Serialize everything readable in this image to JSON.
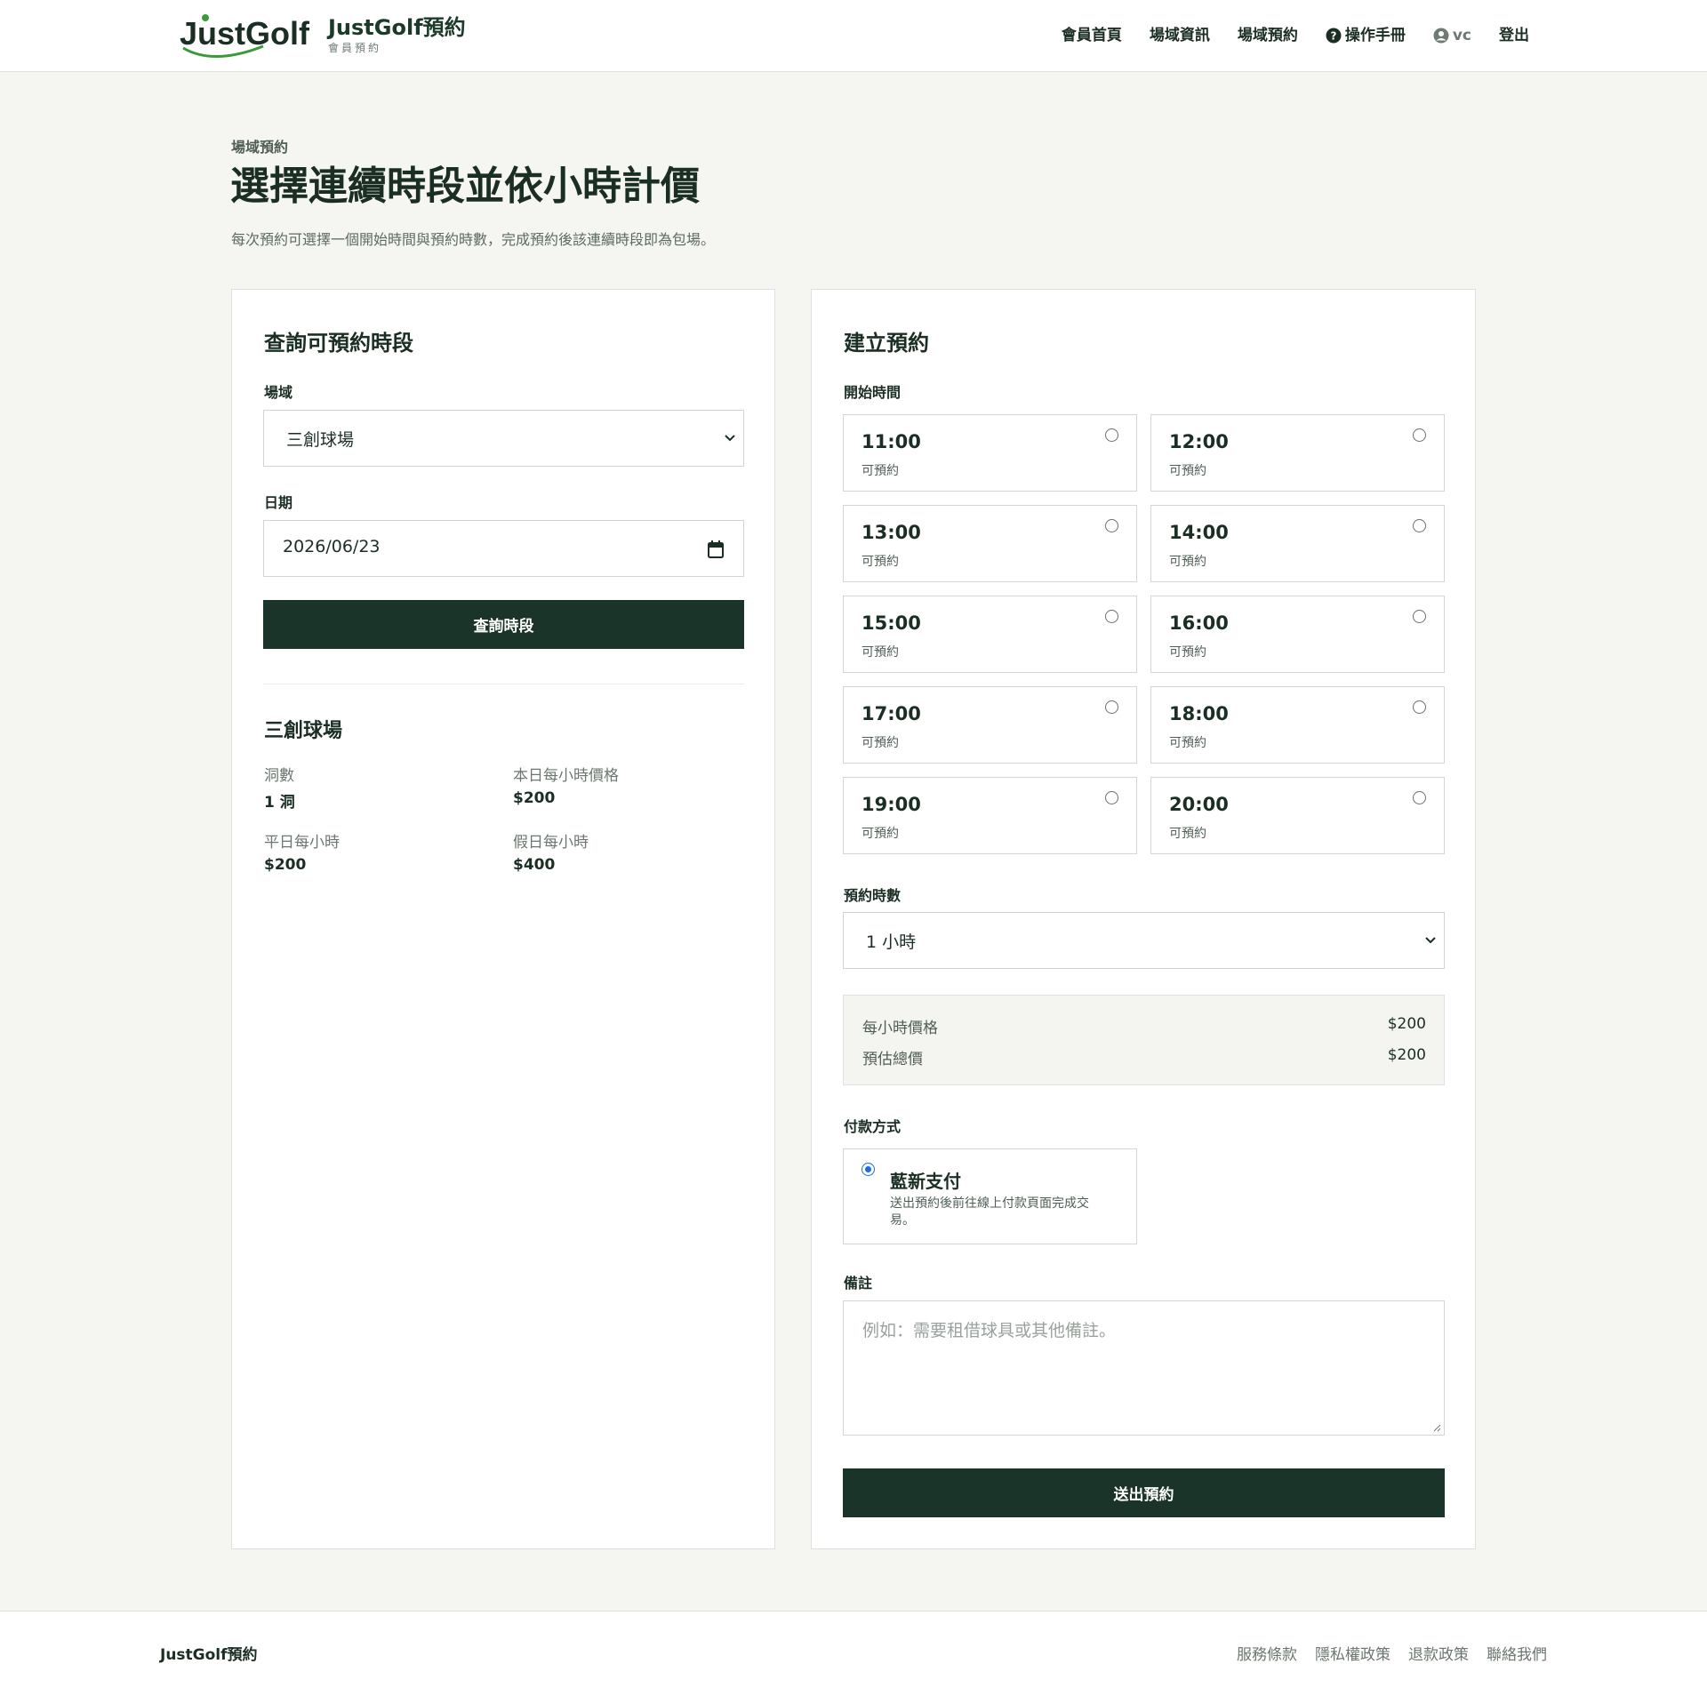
{
  "header": {
    "logo_text": "JustGolf",
    "brand_title": "JustGolf預約",
    "brand_subtitle": "會員預約",
    "nav": {
      "home": "會員首頁",
      "venues": "場域資訊",
      "booking": "場域預約",
      "manual": "操作手冊",
      "user": "vc",
      "logout": "登出"
    }
  },
  "page": {
    "eyebrow": "場域預約",
    "title": "選擇連續時段並依小時計價",
    "description": "每次預約可選擇一個開始時間與預約時數，完成預約後該連續時段即為包場。"
  },
  "query_card": {
    "title": "查詢可預約時段",
    "venue_label": "場域",
    "venue_value": "三創球場",
    "date_label": "日期",
    "date_value": "2026/06/23",
    "submit_label": "查詢時段",
    "venue_info": {
      "name": "三創球場",
      "holes_label": "洞數",
      "holes_value": "1 洞",
      "today_price_label": "本日每小時價格",
      "today_price_value": "$200",
      "weekday_label": "平日每小時",
      "weekday_value": "$200",
      "holiday_label": "假日每小時",
      "holiday_value": "$400"
    }
  },
  "booking_card": {
    "title": "建立預約",
    "start_time_label": "開始時間",
    "slots": [
      {
        "time": "11:00",
        "status": "可預約"
      },
      {
        "time": "12:00",
        "status": "可預約"
      },
      {
        "time": "13:00",
        "status": "可預約"
      },
      {
        "time": "14:00",
        "status": "可預約"
      },
      {
        "time": "15:00",
        "status": "可預約"
      },
      {
        "time": "16:00",
        "status": "可預約"
      },
      {
        "time": "17:00",
        "status": "可預約"
      },
      {
        "time": "18:00",
        "status": "可預約"
      },
      {
        "time": "19:00",
        "status": "可預約"
      },
      {
        "time": "20:00",
        "status": "可預約"
      }
    ],
    "hours_label": "預約時數",
    "hours_value": "1 小時",
    "price": {
      "hourly_label": "每小時價格",
      "hourly_value": "$200",
      "total_label": "預估總價",
      "total_value": "$200"
    },
    "payment_label": "付款方式",
    "payment": {
      "title": "藍新支付",
      "description": "送出預約後前往線上付款頁面完成交易。"
    },
    "note_label": "備註",
    "note_placeholder": "例如：需要租借球具或其他備註。",
    "submit_label": "送出預約"
  },
  "footer": {
    "brand": "JustGolf預約",
    "links": [
      "服務條款",
      "隱私權政策",
      "退款政策",
      "聯絡我們"
    ]
  },
  "colors": {
    "primary_dark": "#1b3429",
    "page_bg": "#f5f5f1",
    "logo_green": "#3a9a3a",
    "radio_blue": "#1a6de3"
  }
}
